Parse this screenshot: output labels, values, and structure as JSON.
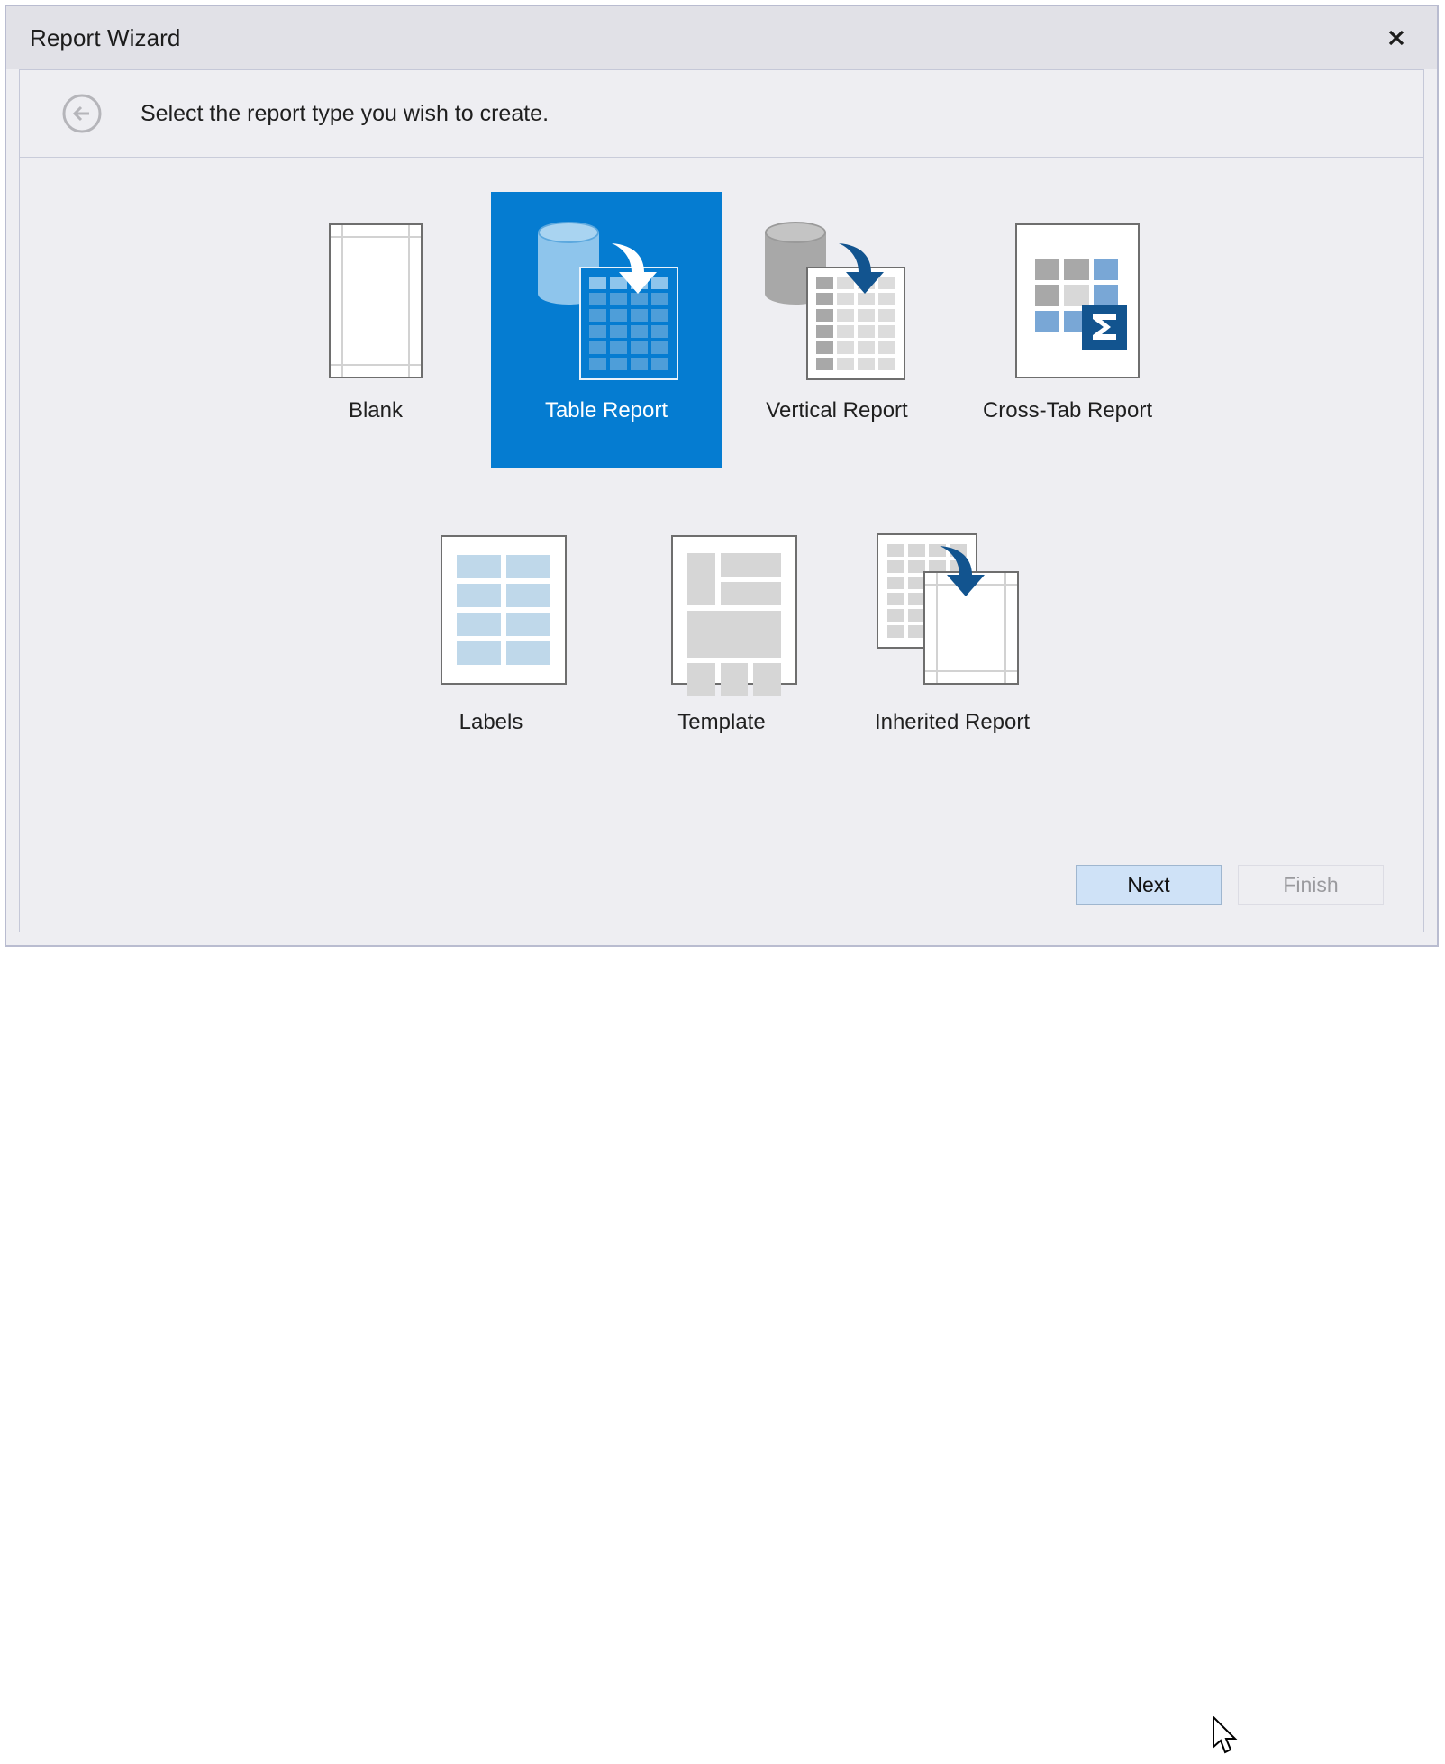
{
  "window": {
    "title": "Report Wizard",
    "close_icon": "close-icon"
  },
  "header": {
    "back_icon": "back-arrow-circle-icon",
    "instruction": "Select the report type you wish to create."
  },
  "report_types": {
    "row1": [
      {
        "id": "blank",
        "label": "Blank",
        "icon": "blank-page-icon",
        "selected": false
      },
      {
        "id": "table",
        "label": "Table Report",
        "icon": "table-report-icon",
        "selected": true
      },
      {
        "id": "vertical",
        "label": "Vertical Report",
        "icon": "vertical-report-icon",
        "selected": false
      },
      {
        "id": "crosstab",
        "label": "Cross-Tab Report",
        "icon": "cross-tab-report-icon",
        "selected": false
      }
    ],
    "row2": [
      {
        "id": "labels",
        "label": "Labels",
        "icon": "labels-icon",
        "selected": false
      },
      {
        "id": "template",
        "label": "Template",
        "icon": "template-icon",
        "selected": false
      },
      {
        "id": "inherited",
        "label": "Inherited Report",
        "icon": "inherited-report-icon",
        "selected": false
      }
    ]
  },
  "footer": {
    "next_label": "Next",
    "finish_label": "Finish",
    "finish_enabled": false
  },
  "colors": {
    "selection_blue": "#057cd1",
    "accent_dark_blue": "#12548f",
    "title_bar": "#e1e1e7",
    "body": "#eeeef2",
    "window_border": "#b9bcd0",
    "button_hover": "#cfe2f7"
  }
}
